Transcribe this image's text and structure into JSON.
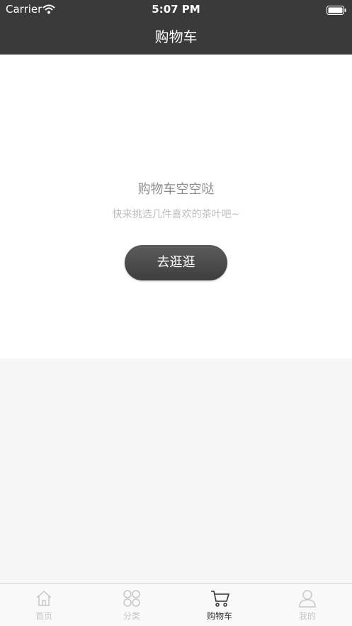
{
  "status_bar": {
    "carrier": "Carrier",
    "time": "5:07 PM"
  },
  "nav": {
    "title": "购物车"
  },
  "empty_state": {
    "title": "购物车空空哒",
    "subtitle": "快来挑选几件喜欢的茶叶吧~",
    "button_label": "去逛逛"
  },
  "tabbar": {
    "items": [
      {
        "label": "首页",
        "icon": "home-icon",
        "active": false
      },
      {
        "label": "分类",
        "icon": "category-icon",
        "active": false
      },
      {
        "label": "购物车",
        "icon": "cart-icon",
        "active": true
      },
      {
        "label": "我的",
        "icon": "person-icon",
        "active": false
      }
    ]
  },
  "colors": {
    "nav_bg": "#3a3a3a",
    "button_bg": "#4a4a4a",
    "page_bg": "#f7f7f7"
  }
}
